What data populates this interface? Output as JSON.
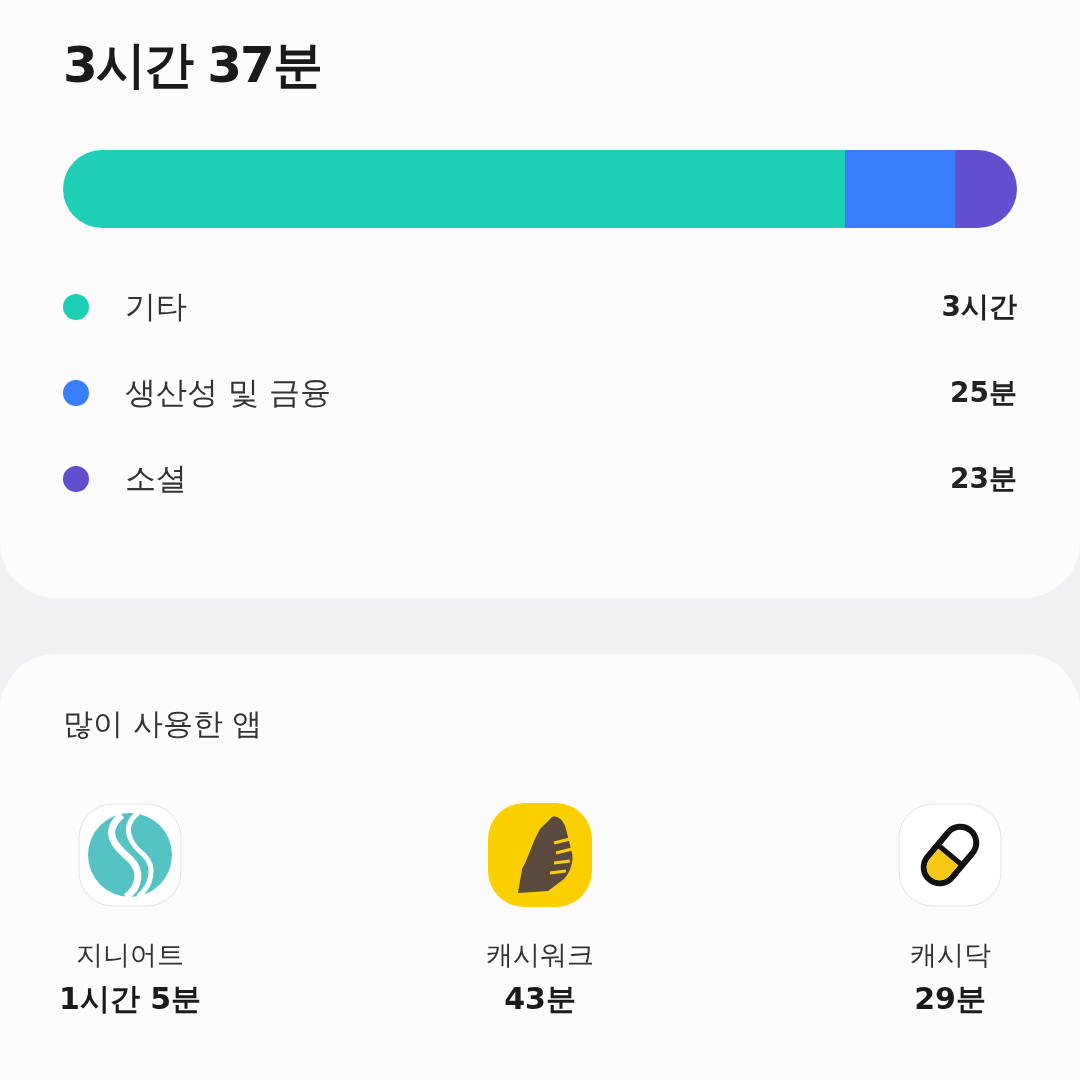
{
  "summary": {
    "total": "3시간 37분",
    "segments": [
      {
        "label": "기타",
        "value": "3시간",
        "color": "#1fcfb5"
      },
      {
        "label": "생산성 및 금융",
        "value": "25분",
        "color": "#3a7dfc"
      },
      {
        "label": "소셜",
        "value": "23분",
        "color": "#614fd0"
      }
    ]
  },
  "top_apps": {
    "title": "많이 사용한 앱",
    "apps": [
      {
        "kind": "waves",
        "name": "지니어트",
        "time": "1시간 5분"
      },
      {
        "kind": "shoe",
        "name": "캐시워크",
        "time": "43분"
      },
      {
        "kind": "pill",
        "name": "캐시닥",
        "time": "29분"
      }
    ]
  }
}
